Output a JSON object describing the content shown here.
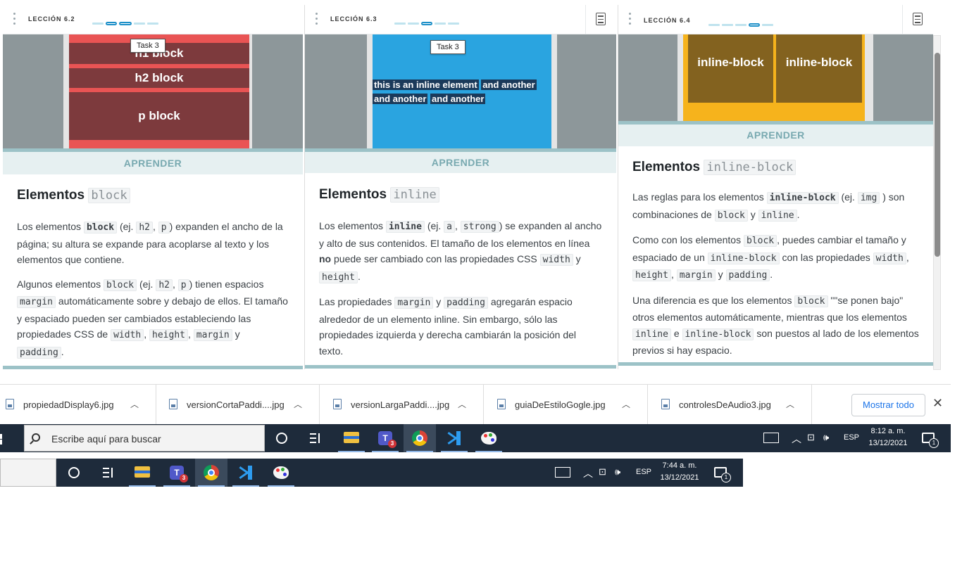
{
  "panels": [
    {
      "lesson": "LECCIÓN 6.2",
      "learn_label": "APRENDER",
      "tooltip": "Task 3",
      "illustration": [
        "h1 block",
        "h2 block",
        "p block"
      ],
      "title_text": "Elementos",
      "title_code": "block",
      "p1": {
        "t1": "Los elementos",
        "c1": "block",
        "t2": "(ej.",
        "c2": "h2",
        "t3": ",",
        "c3": "p",
        "t4": ") expanden el ancho de la página; su altura se expande para acoplarse al texto y los elementos que contiene."
      },
      "p2": {
        "t1": "Algunos elementos",
        "c1": "block",
        "t2": "(ej.",
        "c2": "h2",
        "t3": ",",
        "c3": "p",
        "t4": ") tienen espacios",
        "c4": "margin",
        "t5": "automáticamente sobre y debajo de ellos. El tamaño y espaciado pueden ser cambiados estableciendo las propiedades CSS de",
        "c5": "width",
        "t6": ",",
        "c6": "height",
        "t7": ",",
        "c7": "margin",
        "t8": "y",
        "c8": "padding",
        "t9": "."
      }
    },
    {
      "lesson": "LECCIÓN 6.3",
      "learn_label": "APRENDER",
      "tooltip": "Task 3",
      "illustration": [
        "this is an inline element",
        "and another",
        "and another",
        "and another"
      ],
      "title_text": "Elementos",
      "title_code": "inline",
      "p1": {
        "t1": "Los elementos",
        "c1": "inline",
        "t2": "(ej.",
        "c2": "a",
        "t3": ",",
        "c3": "strong",
        "t4": ") se expanden al ancho y alto de sus contenidos. El tamaño de los elementos en línea",
        "b1": "no",
        "t5": "puede ser cambiado con las propiedades CSS",
        "c4": "width",
        "t6": "y",
        "c5": "height",
        "t7": "."
      },
      "p2": {
        "t1": "Las propiedades",
        "c1": "margin",
        "t2": "y",
        "c2": "padding",
        "t3": "agregarán espacio alrededor de un elemento inline. Sin embargo, sólo las propiedades izquierda y derecha cambiarán la posición del texto."
      }
    },
    {
      "lesson": "LECCIÓN 6.4",
      "learn_label": "APRENDER",
      "illustration": [
        "inline-block",
        "inline-block"
      ],
      "title_text": "Elementos",
      "title_code": "inline-block",
      "p1": {
        "t1": "Las reglas para los elementos",
        "c1": "inline-block",
        "t2": "(ej.",
        "c2": "img",
        "t3": ") son combinaciones de",
        "c3": "block",
        "t4": "y",
        "c4": "inline",
        "t5": "."
      },
      "p2": {
        "t1": "Como con los elementos",
        "c1": "block",
        "t2": ", puedes cambiar el tamaño y espaciado de un",
        "c2": "inline-block",
        "t3": "con las propiedades",
        "c3": "width",
        "t4": ",",
        "c4": "height",
        "t5": ",",
        "c5": "margin",
        "t6": "y",
        "c6": "padding",
        "t7": "."
      },
      "p3": {
        "t1": "Una diferencia es que los elementos",
        "c1": "block",
        "t2": "\"\"se ponen bajo\" otros elementos automáticamente, mientras que los elementos",
        "c2": "inline",
        "t3": "e",
        "c3": "inline-block",
        "t4": "son puestos al lado de los elementos previos si hay espacio."
      }
    }
  ],
  "downloads": {
    "items": [
      "propiedadDisplay6.jpg",
      "versionCortaPaddi....jpg",
      "versionLargaPaddi....jpg",
      "guiaDeEstiloGogle.jpg",
      "controlesDeAudio3.jpg"
    ],
    "show_all": "Mostrar todo"
  },
  "taskbar1": {
    "search_placeholder": "Escribe aquí para buscar",
    "teams_badge": "3",
    "lang": "ESP",
    "time": "8:12 a. m.",
    "date": "13/12/2021",
    "notifications": "1"
  },
  "taskbar2": {
    "teams_badge": "3",
    "lang": "ESP",
    "time": "7:44 a. m.",
    "date": "13/12/2021",
    "notifications": "1"
  }
}
